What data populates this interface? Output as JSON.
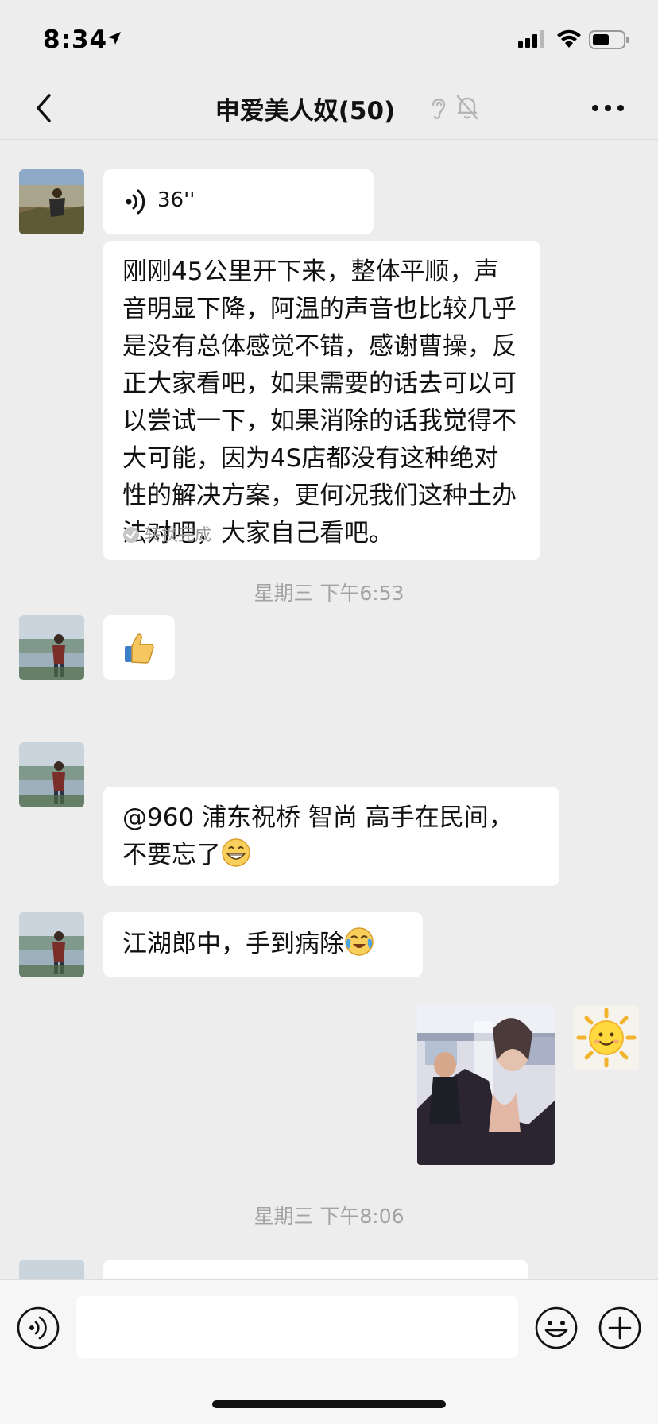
{
  "status_bar": {
    "time": "8:34"
  },
  "header": {
    "title": "申爱美人奴(50)",
    "back_icon": "chevron-left-icon",
    "more_icon": "more-dots-icon",
    "title_icons": [
      "ear-icon",
      "mute-bell-icon"
    ]
  },
  "messages": [
    {
      "type": "voice",
      "duration": "36''"
    },
    {
      "type": "voice_text",
      "text": "刚刚45公里开下来，整体平顺，声音明显下降，阿温的声音也比较几乎是没有总体感觉不错，感谢曹操，反正大家看吧，如果需要的话去可以可以尝试一下，如果消除的话我觉得不大可能，因为4S店都没有这种绝对性的解决方案，更何况我们这种土办法对吧，大家自己看吧。",
      "status": "转换完成"
    },
    {
      "type": "time",
      "text": "星期三 下午6:53"
    },
    {
      "type": "emoji",
      "emoji": "thumbs-up-icon"
    },
    {
      "type": "text",
      "line1": "@960 浦东祝桥 智尚 高手在民间，",
      "line2": "不要忘了"
    },
    {
      "type": "text",
      "text": "江湖郎中，手到病除"
    },
    {
      "type": "image_sent",
      "image": "video-thumbnail"
    },
    {
      "type": "time",
      "text": "星期三 下午8:06"
    }
  ],
  "colors": {
    "background": "#ededed",
    "bubble": "#ffffff",
    "timestamp": "#a3a3a3"
  }
}
